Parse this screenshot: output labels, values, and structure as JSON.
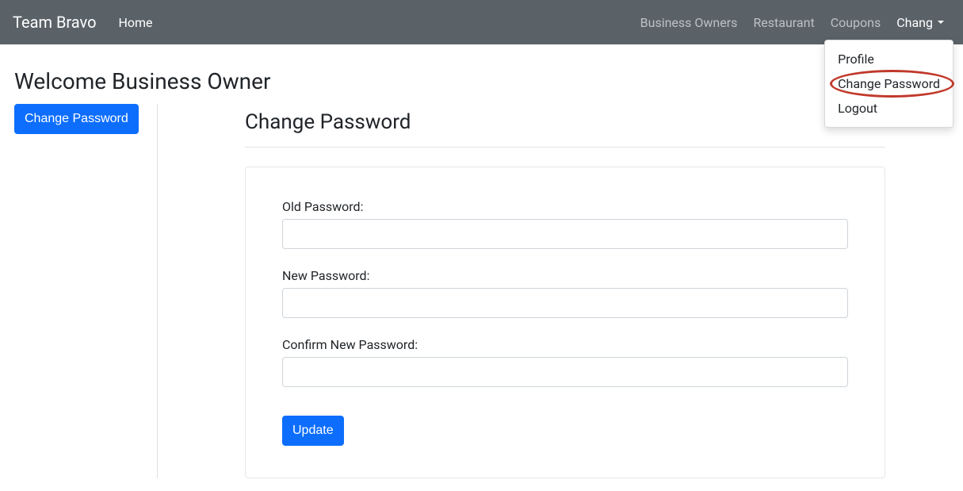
{
  "navbar": {
    "brand": "Team Bravo",
    "home": "Home",
    "links": {
      "business_owners": "Business Owners",
      "restaurant": "Restaurant",
      "coupons": "Coupons"
    },
    "user": "Chang",
    "dropdown": {
      "profile": "Profile",
      "change_password": "Change Password",
      "logout": "Logout"
    }
  },
  "page": {
    "welcome": "Welcome Business Owner"
  },
  "sidebar": {
    "change_password_btn": "Change Password"
  },
  "main": {
    "heading": "Change Password",
    "form": {
      "old_password_label": "Old Password:",
      "new_password_label": "New Password:",
      "confirm_password_label": "Confirm New Password:",
      "submit_label": "Update"
    }
  }
}
